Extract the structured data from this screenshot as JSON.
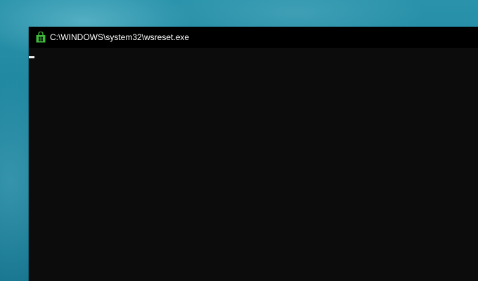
{
  "window": {
    "title": "C:\\WINDOWS\\system32\\wsreset.exe",
    "icon": "microsoft-store-icon",
    "icon_color": "#3fb83b",
    "title_bar_color": "#000000",
    "background_color": "#0c0c0c"
  },
  "console": {
    "cursor_visible": true
  },
  "desktop": {
    "wallpaper_color": "#1f86a0"
  }
}
